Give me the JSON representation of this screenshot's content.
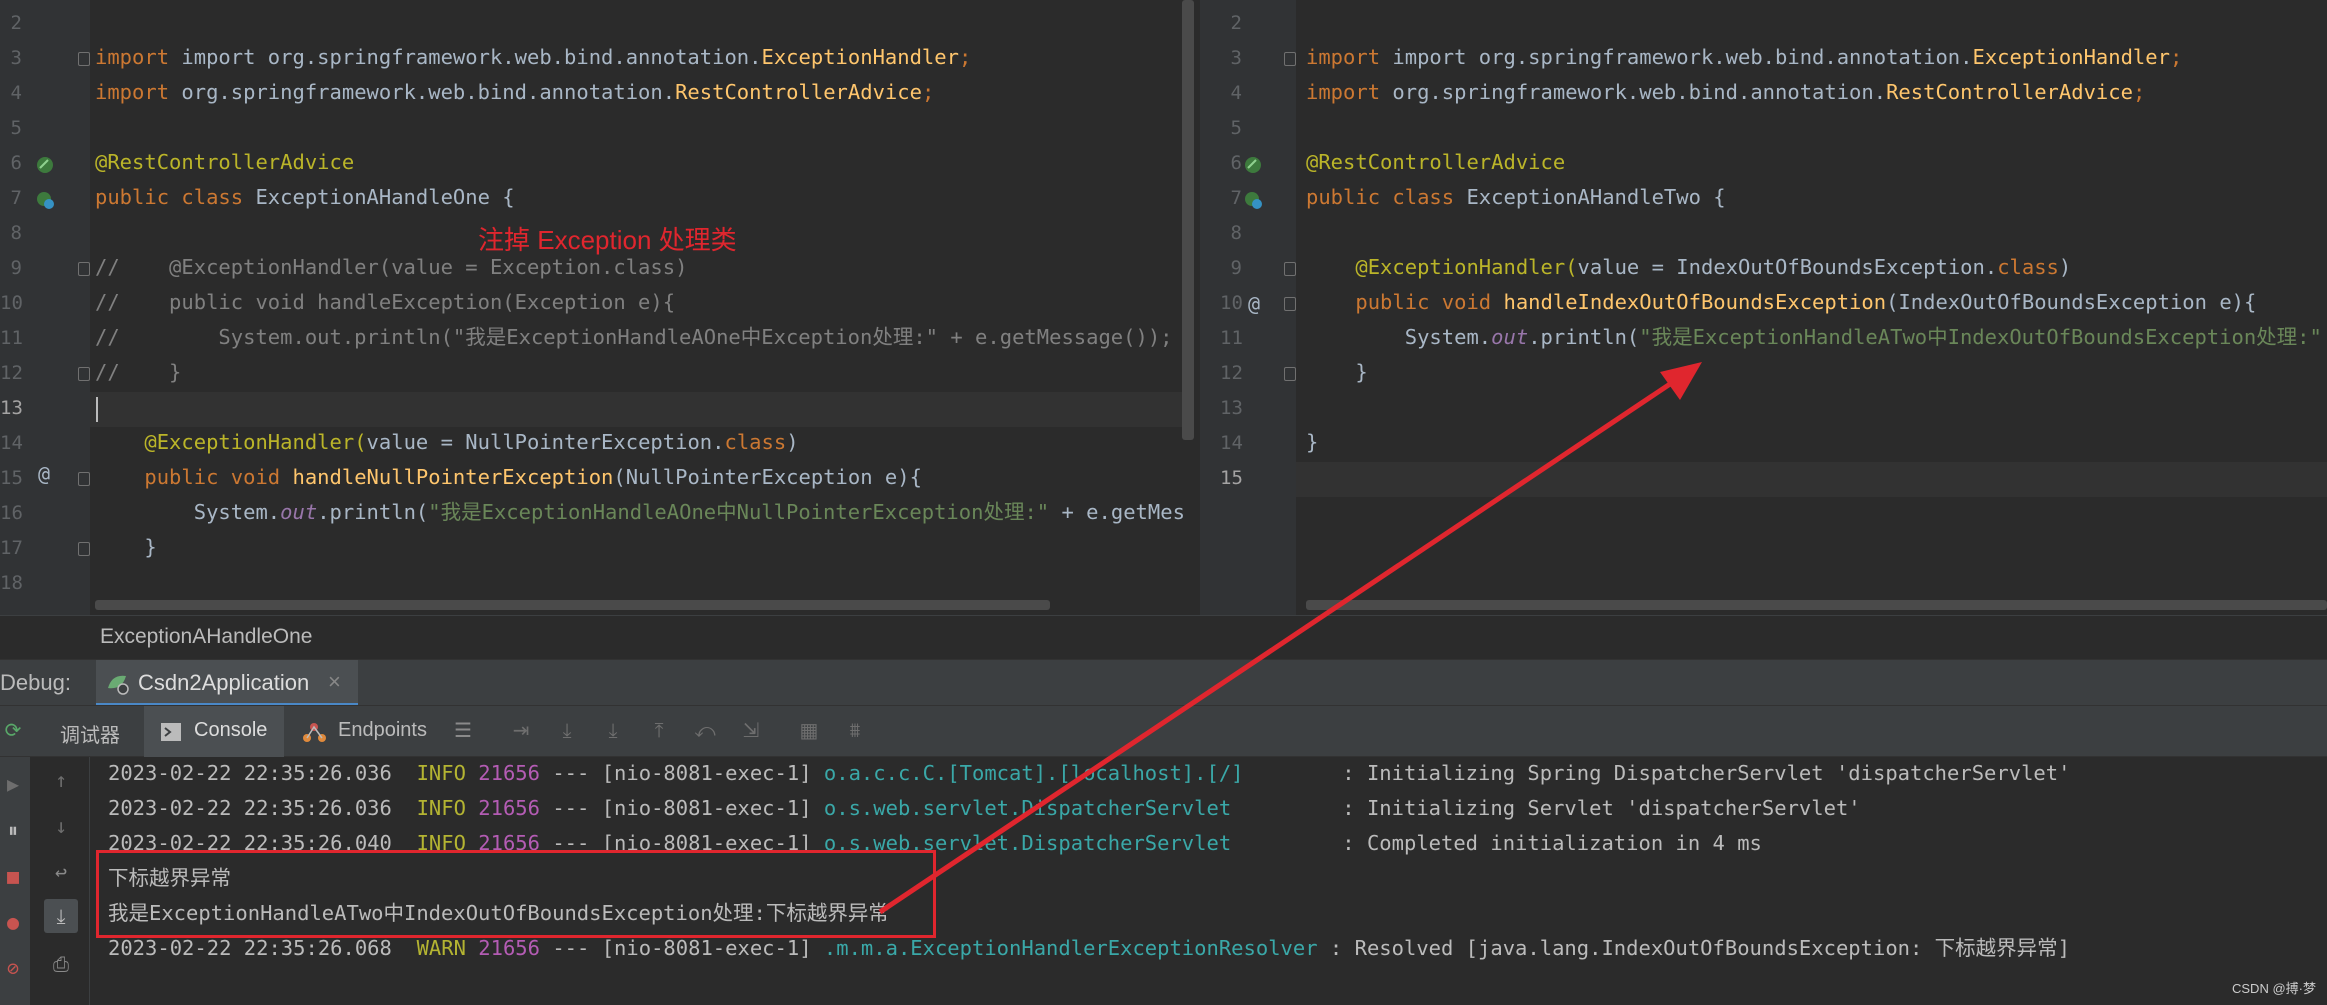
{
  "left_editor": {
    "line_numbers": [
      "2",
      "3",
      "4",
      "5",
      "6",
      "7",
      "8",
      "9",
      "10",
      "11",
      "12",
      "13",
      "14",
      "15",
      "16",
      "17",
      "18"
    ],
    "imports": [
      "import org.springframework.web.bind.annotation.",
      "ExceptionHandler",
      ";",
      "RestControllerAdvice"
    ],
    "annotation": "@RestControllerAdvice",
    "class_decl_kw": "public class",
    "class_name": "ExceptionAHandleOne {",
    "note": "注掉 Exception 处理类",
    "comment1": "//    @ExceptionHandler(value = Exception.class)",
    "comment2": "//    public void handleException(Exception e){",
    "comment3": "//        System.out.println(\"我是ExceptionHandleAOne中Exception处理:\" + e.getMessage());",
    "comment4": "//    }",
    "handler_ann": "@ExceptionHandler(",
    "handler_value": "value",
    "handler_rest": " = NullPointerException.",
    "handler_class_kw": "class",
    "method_kw": "public void",
    "method_name": "handleNullPointerException",
    "method_params": "(NullPointerException e){",
    "print_prefix": "System.",
    "print_out": "out",
    "print_mid": ".println(",
    "print_str": "\"我是ExceptionHandleAOne中NullPointerException处理:\"",
    "print_tail": " + e.getMessag",
    "closing": "}"
  },
  "right_editor": {
    "line_numbers": [
      "2",
      "3",
      "4",
      "5",
      "6",
      "7",
      "8",
      "9",
      "10",
      "11",
      "12",
      "13",
      "14",
      "15"
    ],
    "annotation": "@RestControllerAdvice",
    "class_name": "ExceptionAHandleTwo {",
    "handler_rest": " = IndexOutOfBoundsException.",
    "method_name": "handleIndexOutOfBoundsException",
    "method_params": "(IndexOutOfBoundsException e){",
    "print_str": "\"我是ExceptionHandleATwo中IndexOutOfBoundsException处理:\" +"
  },
  "breadcrumb": "ExceptionAHandleOne",
  "debug_bar": {
    "label": "Debug:",
    "config_name": "Csdn2Application",
    "close": "×"
  },
  "tabs": {
    "debugger": "调试器",
    "console": "Console",
    "endpoints": "Endpoints"
  },
  "console_lines": [
    {
      "ts": "2023-02-22 22:35:26.036",
      "level": "INFO",
      "pid": "21656",
      "sep": " --- ",
      "thread": "[nio-8081-exec-1]",
      "cls": "o.a.c.c.C.[Tomcat].[localhost].[/]       ",
      "msg": ": Initializing Spring DispatcherServlet 'dispatcherServlet'"
    },
    {
      "ts": "2023-02-22 22:35:26.036",
      "level": "INFO",
      "pid": "21656",
      "sep": " --- ",
      "thread": "[nio-8081-exec-1]",
      "cls": "o.s.web.servlet.DispatcherServlet        ",
      "msg": ": Initializing Servlet 'dispatcherServlet'"
    },
    {
      "ts": "2023-02-22 22:35:26.040",
      "level": "INFO",
      "pid": "21656",
      "sep": " --- ",
      "thread": "[nio-8081-exec-1]",
      "cls": "o.s.web.servlet.DispatcherServlet        ",
      "msg": ": Completed initialization in 4 ms"
    },
    {
      "ts": "2023-02-22 22:35:26.068",
      "level": "WARN",
      "pid": "21656",
      "sep": " --- ",
      "thread": "[nio-8081-exec-1]",
      "cls": ".m.m.a.ExceptionHandlerExceptionResolver ",
      "msg": ": Resolved [java.lang.IndexOutOfBoundsException: 下标越界异常]"
    }
  ],
  "console_output": [
    "下标越界异常",
    "我是ExceptionHandleATwo中IndexOutOfBoundsException处理:下标越界异常"
  ],
  "watermark": "CSDN @搏·梦",
  "colors": {
    "highlight_box": "#e0262e",
    "arrow": "#e0262e",
    "note": "#e0262e"
  }
}
